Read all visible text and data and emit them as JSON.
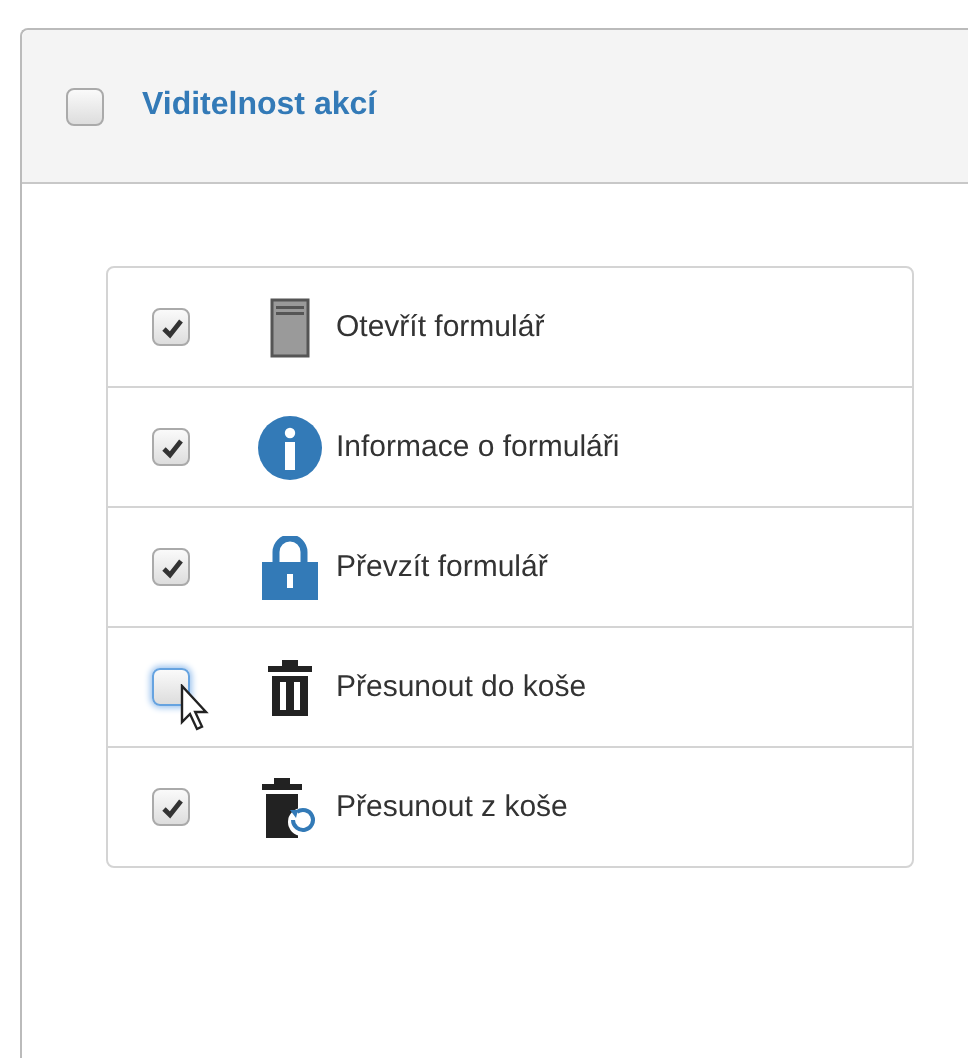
{
  "panel": {
    "title": "Viditelnost akcí",
    "checked": false
  },
  "actions": [
    {
      "kind": "form",
      "label": "Otevřít formulář",
      "checked": true,
      "focused": false
    },
    {
      "kind": "info",
      "label": "Informace o formuláři",
      "checked": true,
      "focused": false
    },
    {
      "kind": "lock",
      "label": "Převzít formulář",
      "checked": true,
      "focused": false
    },
    {
      "kind": "trash",
      "label": "Přesunout do koše",
      "checked": false,
      "focused": true
    },
    {
      "kind": "restore",
      "label": "Přesunout z koše",
      "checked": true,
      "focused": false
    }
  ]
}
